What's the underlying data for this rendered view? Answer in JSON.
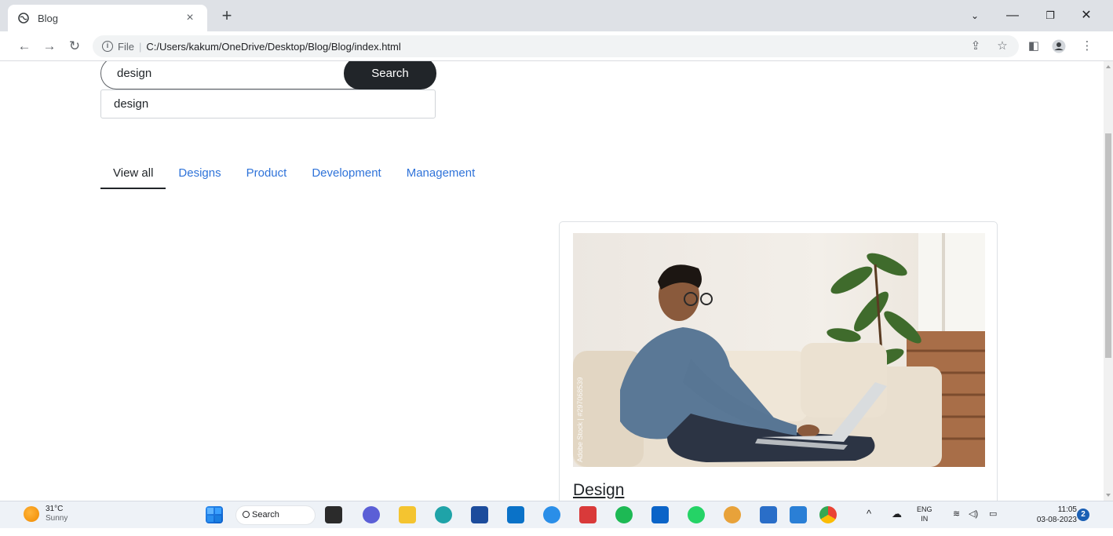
{
  "browser": {
    "tab_title": "Blog",
    "tab_close": "×",
    "new_tab": "+",
    "url_scheme": "File",
    "url": "C:/Users/kakum/OneDrive/Desktop/Blog/Blog/index.html"
  },
  "page": {
    "search": {
      "value": "design",
      "button_label": "Search"
    },
    "suggestion": "design",
    "filters": [
      {
        "label": "View all",
        "active": true
      },
      {
        "label": "Designs",
        "active": false
      },
      {
        "label": "Product",
        "active": false
      },
      {
        "label": "Development",
        "active": false
      },
      {
        "label": "Management",
        "active": false
      }
    ],
    "card": {
      "title": "Design",
      "image_watermark": "Adobe Stock | #297068539"
    }
  },
  "taskbar": {
    "weather_temp": "31°C",
    "weather_desc": "Sunny",
    "search_label": "Search",
    "lang_top": "ENG",
    "lang_bottom": "IN",
    "time": "11:05",
    "date": "03-08-2023",
    "notification_count": "2"
  },
  "colors": {
    "link": "#2f73d9",
    "dark_button": "#212529",
    "tabstrip": "#dee1e6"
  }
}
